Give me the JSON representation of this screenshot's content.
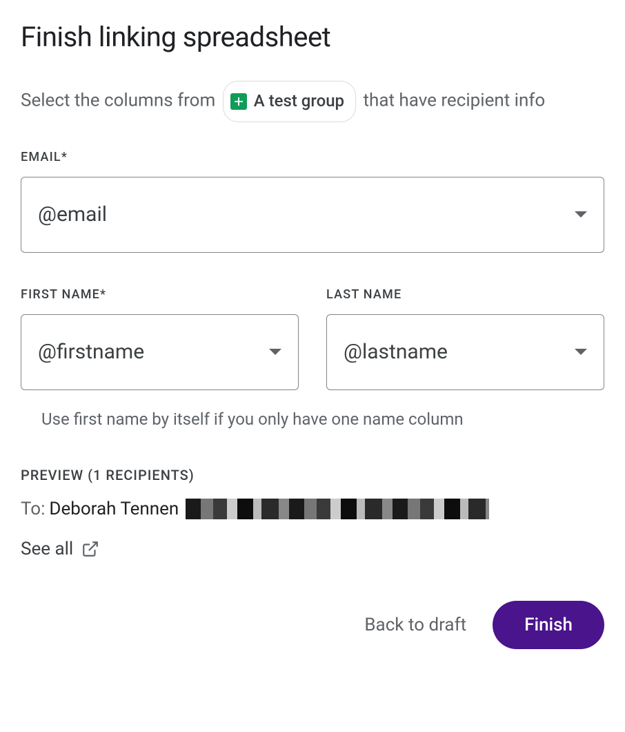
{
  "title": "Finish linking spreadsheet",
  "subtitle_before": "Select the columns from",
  "chip_label": "A test group",
  "subtitle_after": "that have recipient info",
  "fields": {
    "email": {
      "label": "EMAIL*",
      "value": "@email"
    },
    "firstname": {
      "label": "FIRST NAME*",
      "value": "@firstname"
    },
    "lastname": {
      "label": "LAST NAME",
      "value": "@lastname"
    }
  },
  "hint": "Use first name by itself if you only have one name column",
  "preview": {
    "label": "PREVIEW (1 RECIPIENTS)",
    "to_prefix": "To:",
    "recipient_name": "Deborah Tennen",
    "see_all": "See all"
  },
  "buttons": {
    "back": "Back to draft",
    "finish": "Finish"
  }
}
